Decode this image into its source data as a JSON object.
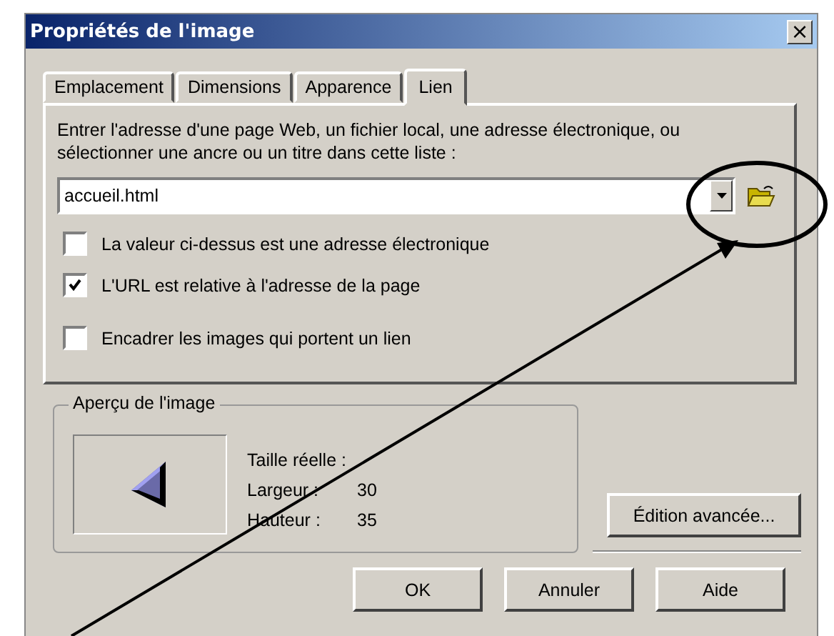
{
  "window": {
    "title": "Propriétés de l'image",
    "close": "×"
  },
  "tabs": [
    {
      "label": "Emplacement",
      "selected": false
    },
    {
      "label": "Dimensions",
      "selected": false
    },
    {
      "label": "Apparence",
      "selected": false
    },
    {
      "label": "Lien",
      "selected": true
    }
  ],
  "link": {
    "instructions": "Entrer l'adresse d'une page Web, un fichier local, une adresse électronique, ou sélectionner une ancre ou un titre dans cette liste :",
    "value": "accueil.html",
    "options": [
      {
        "label": "La valeur ci-dessus est une adresse électronique",
        "checked": false
      },
      {
        "label": "L'URL est relative à l'adresse de la page",
        "checked": true
      },
      {
        "label": "Encadrer les images qui portent un lien",
        "checked": false
      }
    ]
  },
  "preview": {
    "title": "Aperçu de l'image",
    "size_label": "Taille réelle :",
    "rows": [
      {
        "label": "Largeur :",
        "value": "30"
      },
      {
        "label": "Hauteur :",
        "value": "35"
      }
    ]
  },
  "advanced_button": "Édition avancée...",
  "buttons": [
    "OK",
    "Annuler",
    "Aide"
  ]
}
